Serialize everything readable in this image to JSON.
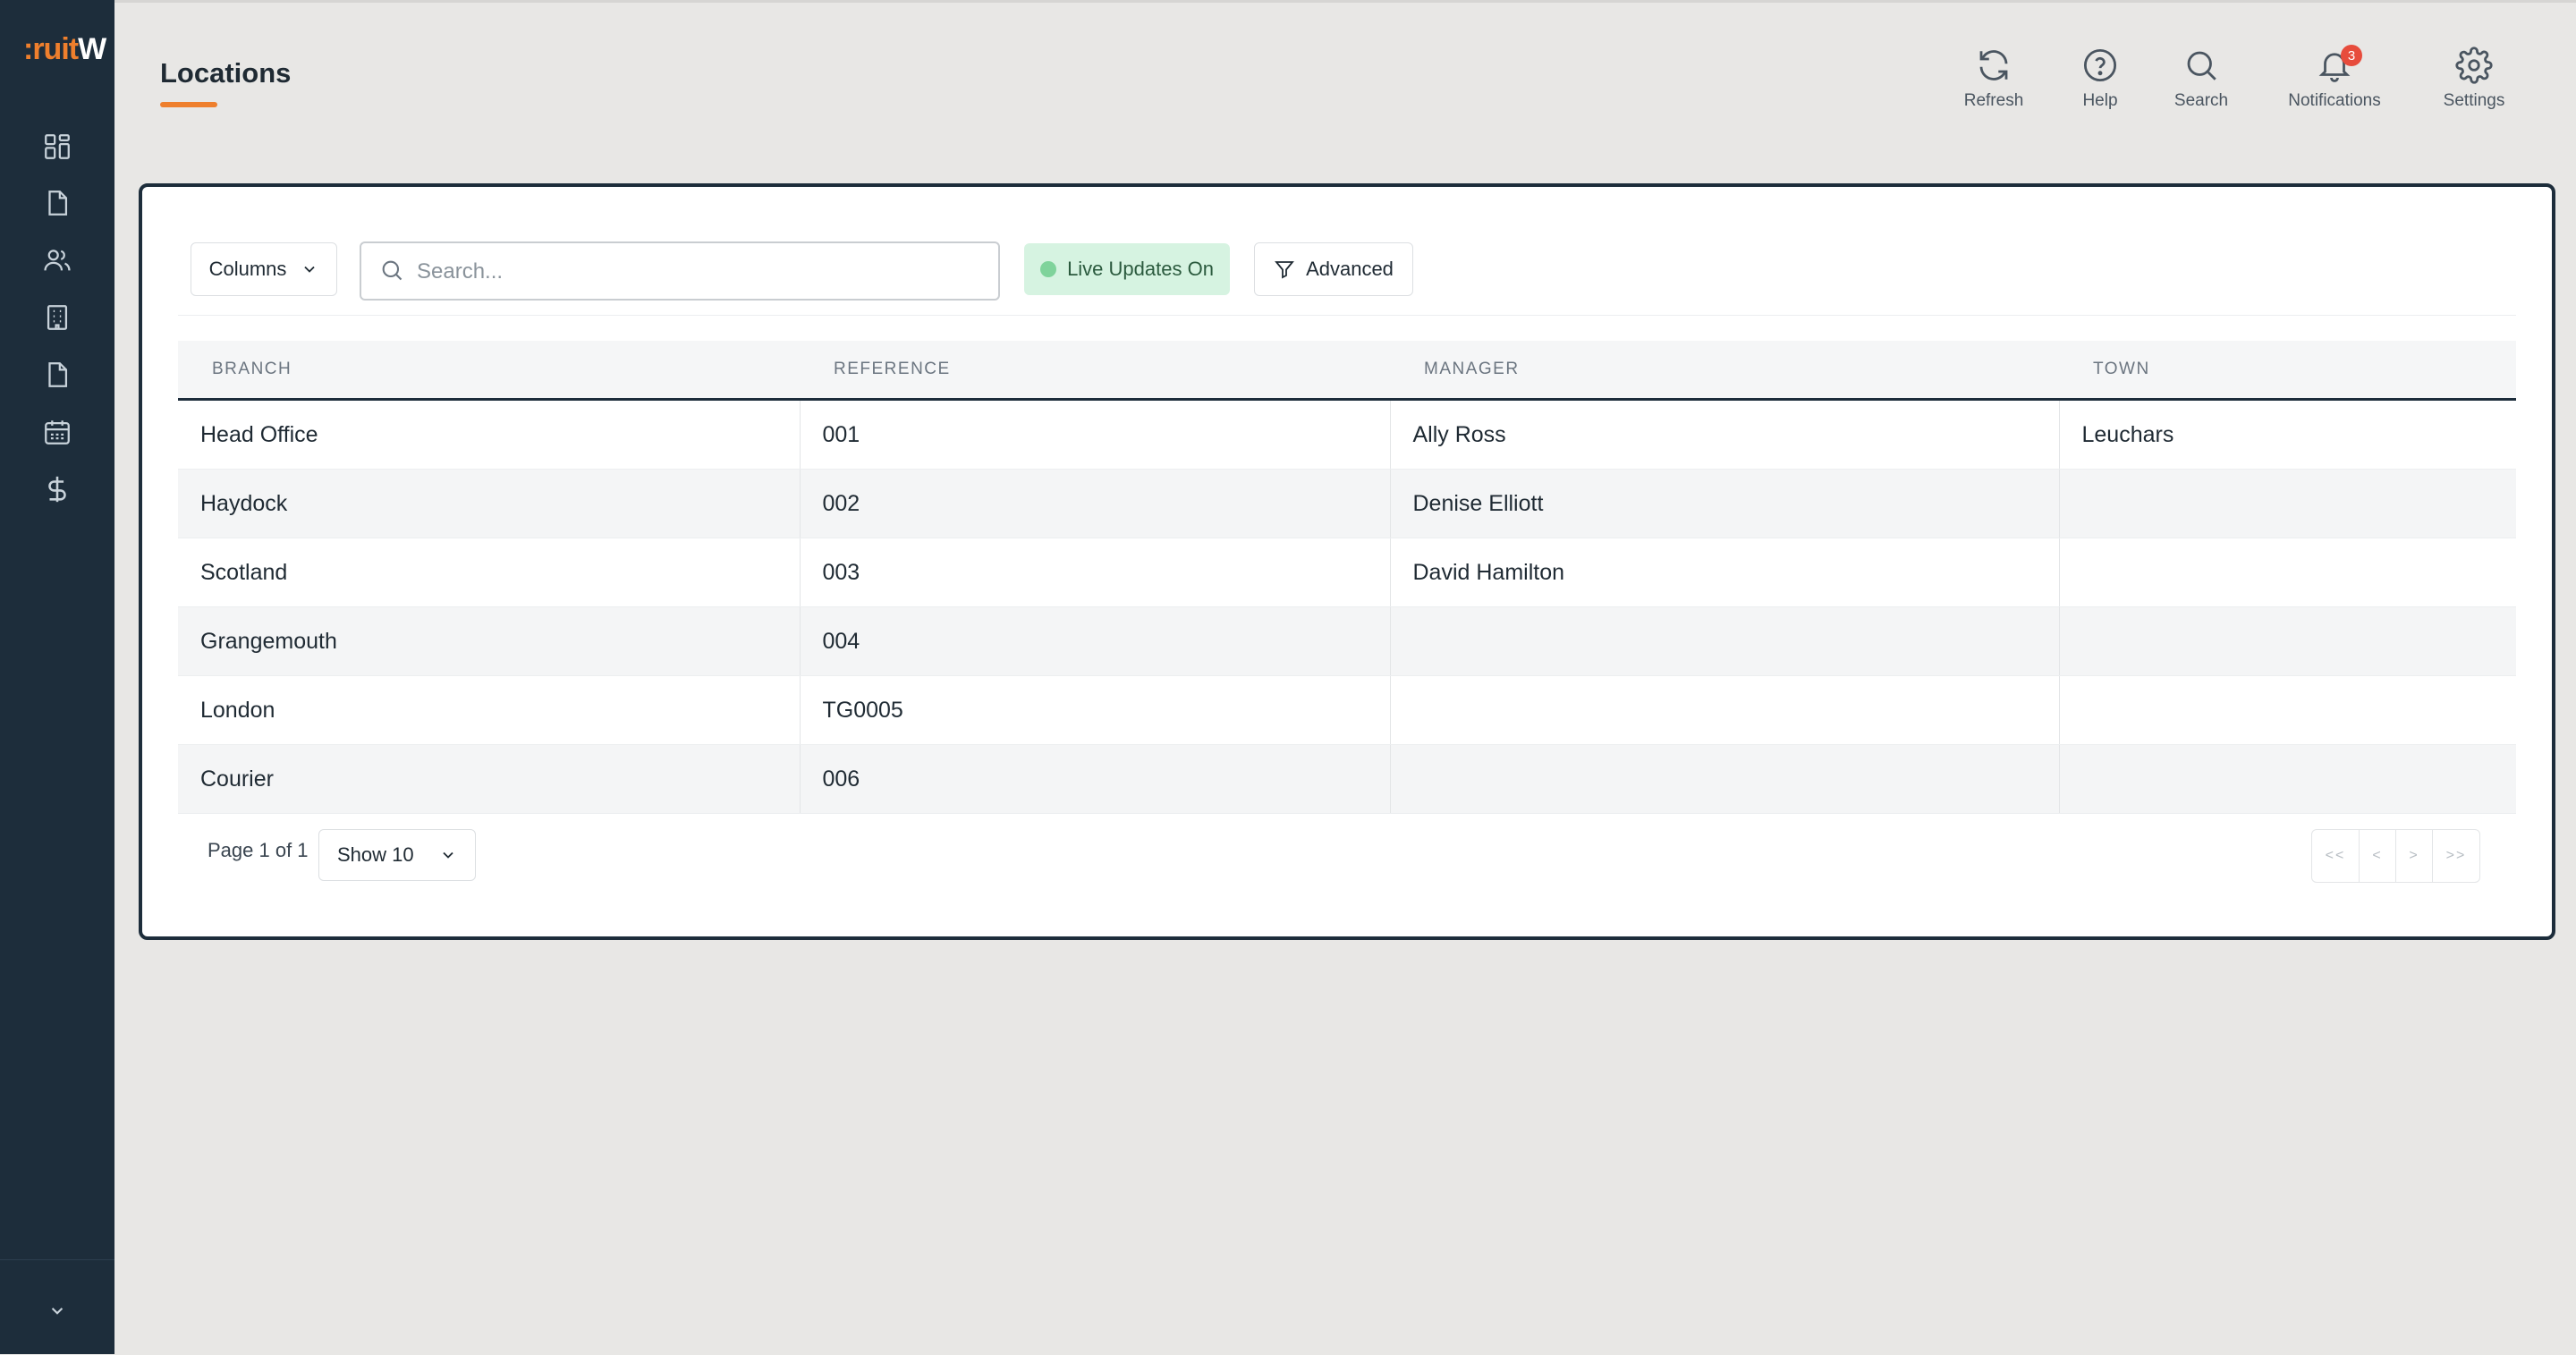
{
  "app": {
    "logo_part1": ":ruit",
    "logo_part2": "W"
  },
  "sidebar": {
    "items": [
      {
        "icon": "dashboard-icon"
      },
      {
        "icon": "document-icon"
      },
      {
        "icon": "users-icon"
      },
      {
        "icon": "building-icon"
      },
      {
        "icon": "file-icon"
      },
      {
        "icon": "calendar-icon"
      },
      {
        "icon": "dollar-icon"
      }
    ],
    "collapse_icon": "chevron-down-icon"
  },
  "header": {
    "title": "Locations",
    "actions": [
      {
        "label": "Refresh",
        "icon": "refresh-icon"
      },
      {
        "label": "Help",
        "icon": "help-icon"
      },
      {
        "label": "Search",
        "icon": "search-icon"
      },
      {
        "label": "Notifications",
        "icon": "bell-icon",
        "badge": "3"
      },
      {
        "label": "Settings",
        "icon": "gear-icon"
      }
    ]
  },
  "toolbar": {
    "columns_label": "Columns",
    "search_placeholder": "Search...",
    "search_value": "",
    "live_label": "Live Updates On",
    "advanced_label": "Advanced"
  },
  "table": {
    "headers": [
      "BRANCH",
      "REFERENCE",
      "MANAGER",
      "TOWN"
    ],
    "rows": [
      [
        "Head Office",
        "001",
        "Ally Ross",
        "Leuchars"
      ],
      [
        "Haydock",
        "002",
        "Denise Elliott",
        ""
      ],
      [
        "Scotland",
        "003",
        "David Hamilton",
        ""
      ],
      [
        "Grangemouth",
        "004",
        "",
        ""
      ],
      [
        "London",
        "TG0005",
        "",
        ""
      ],
      [
        "Courier",
        "006",
        "",
        ""
      ]
    ]
  },
  "pagination": {
    "page_text": "Page 1 of 1",
    "show_label": "Show 10",
    "first": "<<",
    "prev": "<",
    "next": ">",
    "last": ">>"
  },
  "colors": {
    "sidebar": "#1d2d3b",
    "accent": "#ee7f2d",
    "live_bg": "#d6f3e1",
    "badge": "#e74c3c"
  }
}
